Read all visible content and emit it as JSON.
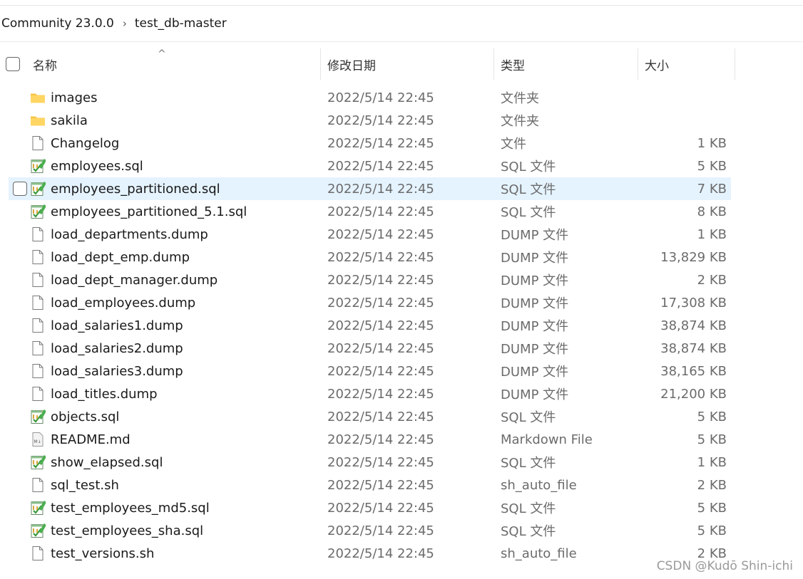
{
  "breadcrumb": {
    "items": [
      "Community 23.0.0",
      "test_db-master"
    ],
    "separator": "›"
  },
  "columns": {
    "name": "名称",
    "modified": "修改日期",
    "type": "类型",
    "size": "大小",
    "sort_indicator": "^"
  },
  "files": [
    {
      "name": "images",
      "date": "2022/5/14 22:45",
      "type": "文件夹",
      "size": "",
      "icon": "folder-icon"
    },
    {
      "name": "sakila",
      "date": "2022/5/14 22:45",
      "type": "文件夹",
      "size": "",
      "icon": "folder-icon"
    },
    {
      "name": "Changelog",
      "date": "2022/5/14 22:45",
      "type": "文件",
      "size": "1 KB",
      "icon": "file-icon"
    },
    {
      "name": "employees.sql",
      "date": "2022/5/14 22:45",
      "type": "SQL 文件",
      "size": "5 KB",
      "icon": "sql-file-icon"
    },
    {
      "name": "employees_partitioned.sql",
      "date": "2022/5/14 22:45",
      "type": "SQL 文件",
      "size": "7 KB",
      "icon": "sql-file-icon",
      "selected": true
    },
    {
      "name": "employees_partitioned_5.1.sql",
      "date": "2022/5/14 22:45",
      "type": "SQL 文件",
      "size": "8 KB",
      "icon": "sql-file-icon"
    },
    {
      "name": "load_departments.dump",
      "date": "2022/5/14 22:45",
      "type": "DUMP 文件",
      "size": "1 KB",
      "icon": "file-icon"
    },
    {
      "name": "load_dept_emp.dump",
      "date": "2022/5/14 22:45",
      "type": "DUMP 文件",
      "size": "13,829 KB",
      "icon": "file-icon"
    },
    {
      "name": "load_dept_manager.dump",
      "date": "2022/5/14 22:45",
      "type": "DUMP 文件",
      "size": "2 KB",
      "icon": "file-icon"
    },
    {
      "name": "load_employees.dump",
      "date": "2022/5/14 22:45",
      "type": "DUMP 文件",
      "size": "17,308 KB",
      "icon": "file-icon"
    },
    {
      "name": "load_salaries1.dump",
      "date": "2022/5/14 22:45",
      "type": "DUMP 文件",
      "size": "38,874 KB",
      "icon": "file-icon"
    },
    {
      "name": "load_salaries2.dump",
      "date": "2022/5/14 22:45",
      "type": "DUMP 文件",
      "size": "38,874 KB",
      "icon": "file-icon"
    },
    {
      "name": "load_salaries3.dump",
      "date": "2022/5/14 22:45",
      "type": "DUMP 文件",
      "size": "38,165 KB",
      "icon": "file-icon"
    },
    {
      "name": "load_titles.dump",
      "date": "2022/5/14 22:45",
      "type": "DUMP 文件",
      "size": "21,200 KB",
      "icon": "file-icon"
    },
    {
      "name": "objects.sql",
      "date": "2022/5/14 22:45",
      "type": "SQL 文件",
      "size": "5 KB",
      "icon": "sql-file-icon"
    },
    {
      "name": "README.md",
      "date": "2022/5/14 22:45",
      "type": "Markdown File",
      "size": "5 KB",
      "icon": "markdown-file-icon"
    },
    {
      "name": "show_elapsed.sql",
      "date": "2022/5/14 22:45",
      "type": "SQL 文件",
      "size": "1 KB",
      "icon": "sql-file-icon"
    },
    {
      "name": "sql_test.sh",
      "date": "2022/5/14 22:45",
      "type": "sh_auto_file",
      "size": "2 KB",
      "icon": "file-icon"
    },
    {
      "name": "test_employees_md5.sql",
      "date": "2022/5/14 22:45",
      "type": "SQL 文件",
      "size": "5 KB",
      "icon": "sql-file-icon"
    },
    {
      "name": "test_employees_sha.sql",
      "date": "2022/5/14 22:45",
      "type": "SQL 文件",
      "size": "5 KB",
      "icon": "sql-file-icon"
    },
    {
      "name": "test_versions.sh",
      "date": "2022/5/14 22:45",
      "type": "sh_auto_file",
      "size": "2 KB",
      "icon": "file-icon"
    }
  ],
  "watermark": "CSDN @Kudō Shin-ichi",
  "colors": {
    "selected_row": "#e5f3ff",
    "folder": "#f6c445",
    "sql_green": "#3a9a3a"
  }
}
